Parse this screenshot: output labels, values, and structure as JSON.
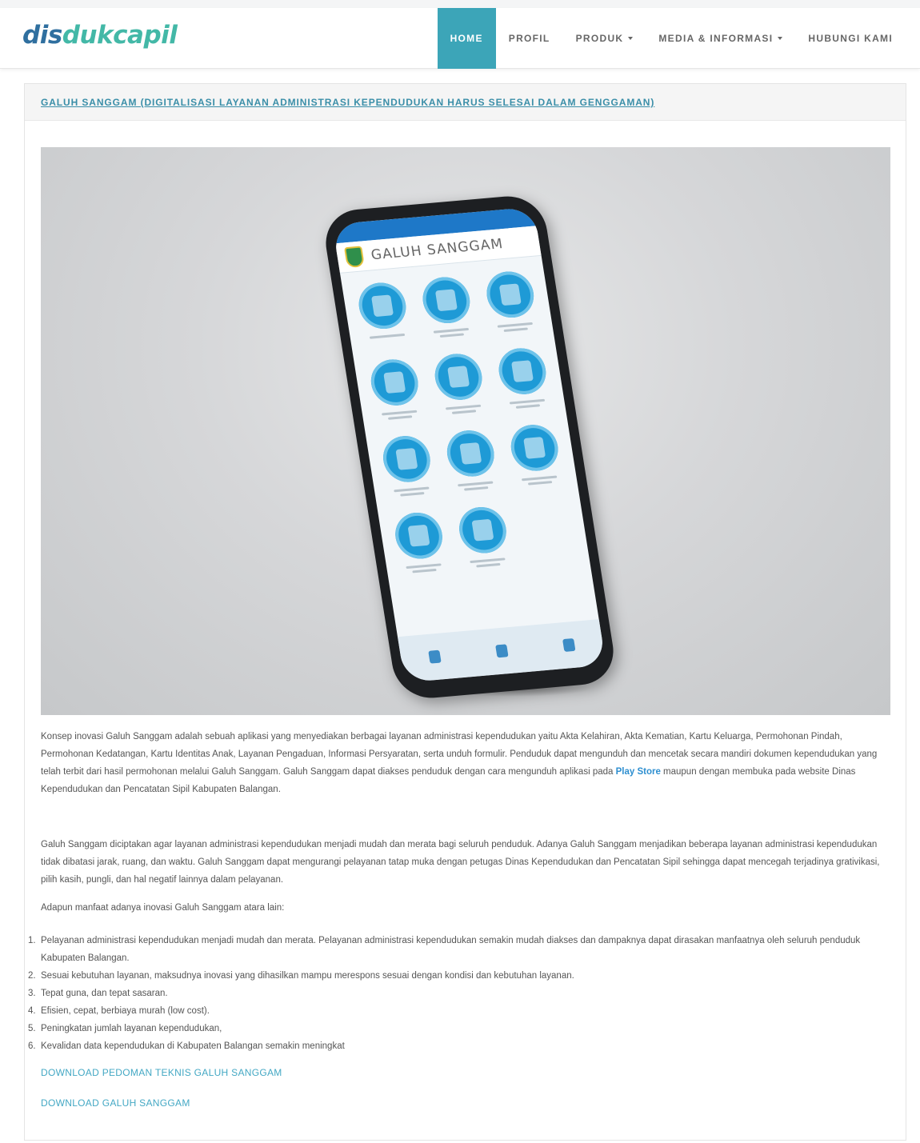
{
  "header": {
    "logo_part1": "dis",
    "logo_part2": "dukcapil",
    "nav": [
      {
        "label": "HOME",
        "active": true
      },
      {
        "label": "PROFIL"
      },
      {
        "label": "PRODUK"
      },
      {
        "label": "MEDIA & INFORMASI"
      },
      {
        "label": "HUBUNGI KAMI"
      }
    ]
  },
  "article": {
    "title": "GALUH SANGGAM (DIGITALISASI LAYANAN ADMINISTRASI KEPENDUDUKAN HARUS SELESAI DALAM GENGGAMAN)",
    "phone_app_title": "GALUH SANGGAM",
    "intro_before_link": "Konsep inovasi Galuh Sanggam adalah sebuah aplikasi yang menyediakan berbagai layanan administrasi kependudukan yaitu Akta Kelahiran, Akta Kematian, Kartu Keluarga, Permohonan Pindah, Permohonan Kedatangan, Kartu Identitas Anak, Layanan Pengaduan, Informasi Persyaratan, serta unduh formulir. Penduduk dapat mengunduh dan mencetak secara mandiri dokumen kependudukan yang telah terbit dari hasil permohonan melalui Galuh Sanggam. Galuh Sanggam dapat diakses penduduk dengan cara mengunduh aplikasi pada ",
    "intro_link": "Play Store",
    "intro_after_link": " maupun dengan membuka pada website Dinas Kependudukan dan Pencatatan Sipil Kabupaten Balangan.",
    "paragraph2": "Galuh Sanggam diciptakan agar layanan administrasi kependudukan menjadi mudah dan merata bagi seluruh penduduk.  Adanya Galuh Sanggam menjadikan beberapa layanan administrasi kependudukan tidak dibatasi jarak, ruang, dan waktu. Galuh Sanggam dapat mengurangi pelayanan tatap muka dengan petugas Dinas Kependudukan dan Pencatatan Sipil sehingga dapat mencegah terjadinya grativikasi, pilih kasih, pungli, dan hal negatif lainnya dalam pelayanan.",
    "paragraph3": "Adapun manfaat adanya inovasi Galuh Sanggam atara lain:",
    "benefits": [
      "Pelayanan administrasi kependudukan menjadi mudah dan merata. Pelayanan administrasi kependudukan semakin mudah diakses dan dampaknya dapat dirasakan manfaatnya oleh seluruh penduduk Kabupaten Balangan.",
      "Sesuai kebutuhan layanan, maksudnya inovasi yang dihasilkan mampu merespons sesuai dengan kondisi dan kebutuhan layanan.",
      "Tepat guna, dan tepat sasaran.",
      "Efisien, cepat, berbiaya murah (low cost).",
      "Peningkatan jumlah layanan kependudukan,",
      "Kevalidan data kependudukan di Kabupaten Balangan semakin meningkat"
    ],
    "download1": "DOWNLOAD PEDOMAN TEKNIS GALUH SANGGAM",
    "download2": "DOWNLOAD GALUH SANGGAM"
  }
}
